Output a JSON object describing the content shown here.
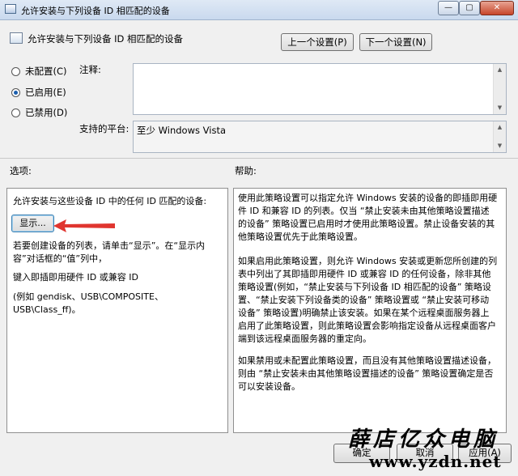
{
  "window": {
    "title": "允许安装与下列设备 ID 相匹配的设备",
    "min_glyph": "—",
    "max_glyph": "▢",
    "close_glyph": "✕"
  },
  "header": {
    "title": "允许安装与下列设备 ID 相匹配的设备",
    "prev_button": "上一个设置(P)",
    "next_button": "下一个设置(N)"
  },
  "state": {
    "options": [
      {
        "label": "未配置(C)",
        "checked": false
      },
      {
        "label": "已启用(E)",
        "checked": true
      },
      {
        "label": "已禁用(D)",
        "checked": false
      }
    ],
    "comment_label": "注释:",
    "comment_value": "",
    "platform_label": "支持的平台:",
    "platform_value": "至少 Windows Vista"
  },
  "options_section": {
    "heading": "选项:",
    "line1": "允许安装与这些设备 ID 中的任何 ID 匹配的设备:",
    "show_button": "显示...",
    "line2a": "若要创建设备的列表，请单击“显示”。在“显示内",
    "line2b": "容”对话框的“值”列中，",
    "line3": "键入即插即用硬件 ID 或兼容 ID",
    "line4a": "(例如 gendisk、USB\\COMPOSITE、",
    "line4b": "USB\\Class_ff)。"
  },
  "help_section": {
    "heading": "帮助:",
    "p1": [
      "使用此策略设置可以指定允许 Windows 安装的设备的即插即用硬",
      "件 ID 和兼容 ID 的列表。仅当 “禁止安装未由其他策略设置描述",
      "的设备” 策略设置已启用时才使用此策略设置。禁止设备安装的其",
      "他策略设置优先于此策略设置。"
    ],
    "p2": [
      "如果启用此策略设置，则允许 Windows 安装或更新您所创建的列",
      "表中列出了其即插即用硬件 ID 或兼容 ID 的任何设备，除非其他",
      "策略设置(例如，“禁止安装与下列设备 ID 相匹配的设备” 策略设",
      "置、“禁止安装下列设备类的设备” 策略设置或 “禁止安装可移动",
      "设备” 策略设置)明确禁止该安装。如果在某个远程桌面服务器上",
      "启用了此策略设置，则此策略设置会影响指定设备从远程桌面客户",
      "端到该远程桌面服务器的重定向。"
    ],
    "p3": [
      "如果禁用或未配置此策略设置，而且没有其他策略设置描述设备，",
      "则由 “禁止安装未由其他策略设置描述的设备” 策略设置确定是否",
      "可以安装设备。"
    ]
  },
  "footer": {
    "ok_button": "确定",
    "cancel_button": "取消",
    "apply_button": "应用(A)"
  },
  "watermark": {
    "line1": "薛店亿众电脑",
    "line2": "www.yzdn.net"
  },
  "colors": {
    "accent": "#1b5fae",
    "arrow": "#e0352f"
  },
  "icons": {
    "window_icon": "policy-window-icon",
    "header_icon": "policy-setting-icon"
  }
}
